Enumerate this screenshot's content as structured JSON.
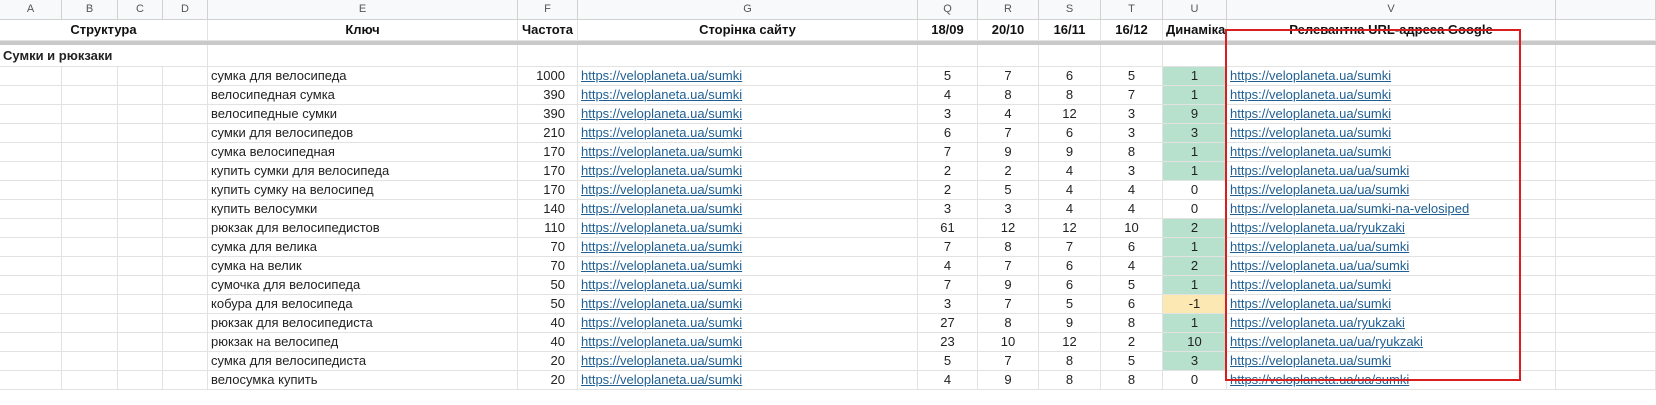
{
  "column_letters": [
    "A",
    "B",
    "C",
    "D",
    "E",
    "F",
    "G",
    "Q",
    "R",
    "S",
    "T",
    "U",
    "V",
    ""
  ],
  "headers": {
    "structure": "Структура",
    "key": "Ключ",
    "frequency": "Частота",
    "site_page": "Сторінка сайту",
    "d1": "18/09",
    "d2": "20/10",
    "d3": "16/11",
    "d4": "16/12",
    "dynamics": "Динаміка",
    "relevant_url": "Релевантна URL-адреса Google"
  },
  "section": "Сумки и рюкзаки",
  "rows": [
    {
      "key": "сумка для велосипеда",
      "freq": "1000",
      "page": "https://veloplaneta.ua/sumki",
      "p1": "5",
      "p2": "7",
      "p3": "6",
      "p4": "5",
      "dyn": "1",
      "url": "https://veloplaneta.ua/sumki"
    },
    {
      "key": "велосипедная сумка",
      "freq": "390",
      "page": "https://veloplaneta.ua/sumki",
      "p1": "4",
      "p2": "8",
      "p3": "8",
      "p4": "7",
      "dyn": "1",
      "url": "https://veloplaneta.ua/sumki"
    },
    {
      "key": "велосипедные сумки",
      "freq": "390",
      "page": "https://veloplaneta.ua/sumki",
      "p1": "3",
      "p2": "4",
      "p3": "12",
      "p4": "3",
      "dyn": "9",
      "url": "https://veloplaneta.ua/sumki"
    },
    {
      "key": "сумки для велосипедов",
      "freq": "210",
      "page": "https://veloplaneta.ua/sumki",
      "p1": "6",
      "p2": "7",
      "p3": "6",
      "p4": "3",
      "dyn": "3",
      "url": "https://veloplaneta.ua/sumki"
    },
    {
      "key": "сумка велосипедная",
      "freq": "170",
      "page": "https://veloplaneta.ua/sumki",
      "p1": "7",
      "p2": "9",
      "p3": "9",
      "p4": "8",
      "dyn": "1",
      "url": "https://veloplaneta.ua/sumki"
    },
    {
      "key": "купить сумки для велосипеда",
      "freq": "170",
      "page": "https://veloplaneta.ua/sumki",
      "p1": "2",
      "p2": "2",
      "p3": "4",
      "p4": "3",
      "dyn": "1",
      "url": "https://veloplaneta.ua/ua/sumki"
    },
    {
      "key": "купить сумку на велосипед",
      "freq": "170",
      "page": "https://veloplaneta.ua/sumki",
      "p1": "2",
      "p2": "5",
      "p3": "4",
      "p4": "4",
      "dyn": "0",
      "url": "https://veloplaneta.ua/ua/sumki"
    },
    {
      "key": "купить велосумки",
      "freq": "140",
      "page": "https://veloplaneta.ua/sumki",
      "p1": "3",
      "p2": "3",
      "p3": "4",
      "p4": "4",
      "dyn": "0",
      "url": "https://veloplaneta.ua/sumki-na-velosiped"
    },
    {
      "key": "рюкзак для велосипедистов",
      "freq": "110",
      "page": "https://veloplaneta.ua/sumki",
      "p1": "61",
      "p2": "12",
      "p3": "12",
      "p4": "10",
      "dyn": "2",
      "url": "https://veloplaneta.ua/ryukzaki"
    },
    {
      "key": "сумка для велика",
      "freq": "70",
      "page": "https://veloplaneta.ua/sumki",
      "p1": "7",
      "p2": "8",
      "p3": "7",
      "p4": "6",
      "dyn": "1",
      "url": "https://veloplaneta.ua/ua/sumki"
    },
    {
      "key": "сумка на велик",
      "freq": "70",
      "page": "https://veloplaneta.ua/sumki",
      "p1": "4",
      "p2": "7",
      "p3": "6",
      "p4": "4",
      "dyn": "2",
      "url": "https://veloplaneta.ua/ua/sumki"
    },
    {
      "key": "сумочка для велосипеда",
      "freq": "50",
      "page": "https://veloplaneta.ua/sumki",
      "p1": "7",
      "p2": "9",
      "p3": "6",
      "p4": "5",
      "dyn": "1",
      "url": "https://veloplaneta.ua/sumki"
    },
    {
      "key": "кобура для велосипеда",
      "freq": "50",
      "page": "https://veloplaneta.ua/sumki",
      "p1": "3",
      "p2": "7",
      "p3": "5",
      "p4": "6",
      "dyn": "-1",
      "url": "https://veloplaneta.ua/sumki"
    },
    {
      "key": "рюкзак для велосипедиста",
      "freq": "40",
      "page": "https://veloplaneta.ua/sumki",
      "p1": "27",
      "p2": "8",
      "p3": "9",
      "p4": "8",
      "dyn": "1",
      "url": "https://veloplaneta.ua/ryukzaki"
    },
    {
      "key": "рюкзак на велосипед",
      "freq": "40",
      "page": "https://veloplaneta.ua/sumki",
      "p1": "23",
      "p2": "10",
      "p3": "12",
      "p4": "2",
      "dyn": "10",
      "url": "https://veloplaneta.ua/ua/ryukzaki"
    },
    {
      "key": "сумка для велосипедиста",
      "freq": "20",
      "page": "https://veloplaneta.ua/sumki",
      "p1": "5",
      "p2": "7",
      "p3": "8",
      "p4": "5",
      "dyn": "3",
      "url": "https://veloplaneta.ua/sumki"
    },
    {
      "key": "велосумка купить",
      "freq": "20",
      "page": "https://veloplaneta.ua/sumki",
      "p1": "4",
      "p2": "9",
      "p3": "8",
      "p4": "8",
      "dyn": "0",
      "url": "https://veloplaneta.ua/ua/sumki"
    }
  ],
  "colors": {
    "positive": "#b7e1cd",
    "negative": "#fce8b2",
    "link": "#1f5f93",
    "highlight": "#d81e1e"
  }
}
